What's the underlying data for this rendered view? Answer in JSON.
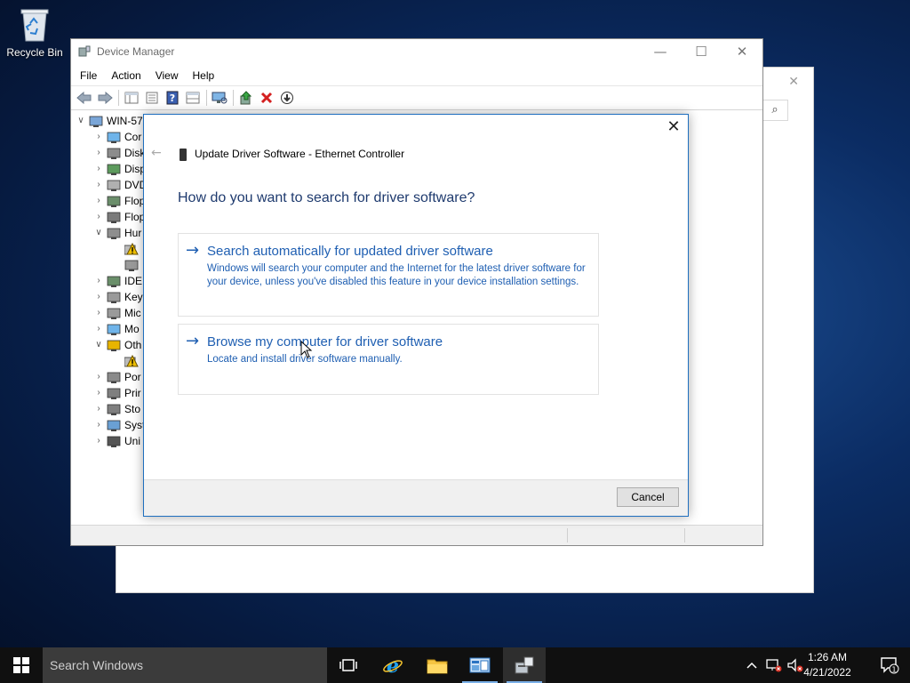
{
  "desktop": {
    "recycle_bin_label": "Recycle Bin"
  },
  "device_manager": {
    "title": "Device Manager",
    "window_buttons": {
      "minimize": "—",
      "maximize": "☐",
      "close": "✕"
    },
    "menu": [
      "File",
      "Action",
      "View",
      "Help"
    ],
    "toolbar_icons": [
      "back-icon",
      "forward-icon",
      "show-hide-console-tree-icon",
      "properties-icon",
      "help-icon",
      "view-icon",
      "scan-hardware-icon",
      "update-driver-icon",
      "uninstall-icon",
      "disable-icon"
    ],
    "tree": [
      {
        "label": "WIN-57",
        "expander": "expanded",
        "depth": 0,
        "icon": "computer-icon"
      },
      {
        "label": "Cor",
        "expander": "collapsed",
        "depth": 1,
        "icon": "monitor-icon"
      },
      {
        "label": "Disk",
        "expander": "collapsed",
        "depth": 1,
        "icon": "disk-drive-icon"
      },
      {
        "label": "Disp",
        "expander": "collapsed",
        "depth": 1,
        "icon": "display-adapter-icon"
      },
      {
        "label": "DVD",
        "expander": "collapsed",
        "depth": 1,
        "icon": "dvd-drive-icon"
      },
      {
        "label": "Flop",
        "expander": "collapsed",
        "depth": 1,
        "icon": "floppy-controller-icon"
      },
      {
        "label": "Flop",
        "expander": "collapsed",
        "depth": 1,
        "icon": "floppy-drive-icon"
      },
      {
        "label": "Hur",
        "expander": "expanded",
        "depth": 1,
        "icon": "hid-icon"
      },
      {
        "label": "",
        "expander": "none",
        "depth": 2,
        "icon": "warning-device-icon"
      },
      {
        "label": "",
        "expander": "none",
        "depth": 2,
        "icon": "hid-device-icon"
      },
      {
        "label": "IDE",
        "expander": "collapsed",
        "depth": 1,
        "icon": "ide-controller-icon"
      },
      {
        "label": "Key",
        "expander": "collapsed",
        "depth": 1,
        "icon": "keyboard-icon"
      },
      {
        "label": "Mic",
        "expander": "collapsed",
        "depth": 1,
        "icon": "mouse-icon"
      },
      {
        "label": "Mo",
        "expander": "collapsed",
        "depth": 1,
        "icon": "monitor-icon"
      },
      {
        "label": "Oth",
        "expander": "expanded",
        "depth": 1,
        "icon": "other-devices-icon"
      },
      {
        "label": "",
        "expander": "none",
        "depth": 2,
        "icon": "warning-device-icon"
      },
      {
        "label": "Por",
        "expander": "collapsed",
        "depth": 1,
        "icon": "ports-icon"
      },
      {
        "label": "Prir",
        "expander": "collapsed",
        "depth": 1,
        "icon": "printer-icon"
      },
      {
        "label": "Sto",
        "expander": "collapsed",
        "depth": 1,
        "icon": "storage-icon"
      },
      {
        "label": "Syst",
        "expander": "collapsed",
        "depth": 1,
        "icon": "system-devices-icon"
      },
      {
        "label": "Uni",
        "expander": "collapsed",
        "depth": 1,
        "icon": "usb-icon"
      }
    ]
  },
  "dialog": {
    "header": "Update Driver Software - Ethernet Controller",
    "question": "How do you want to search for driver software?",
    "options": [
      {
        "title": "Search automatically for updated driver software",
        "description": "Windows will search your computer and the Internet for the latest driver software for your device, unless you've disabled this feature in your device installation settings."
      },
      {
        "title": "Browse my computer for driver software",
        "description": "Locate and install driver software manually."
      }
    ],
    "cancel_label": "Cancel",
    "close_glyph": "✕",
    "back_glyph": "←",
    "arrow_glyph": "→"
  },
  "taskbar": {
    "search_placeholder": "Search Windows",
    "pinned": [
      "task-view-icon",
      "internet-explorer-icon",
      "file-explorer-icon",
      "server-manager-icon",
      "device-manager-icon"
    ],
    "clock_time": "1:26 AM",
    "clock_date": "4/21/2022",
    "notification_count": "1"
  },
  "colors": {
    "link_blue": "#1f5fb2",
    "heading_blue": "#1e3a6e",
    "dialog_border": "#1f6fbf",
    "taskbar": "#101010"
  }
}
